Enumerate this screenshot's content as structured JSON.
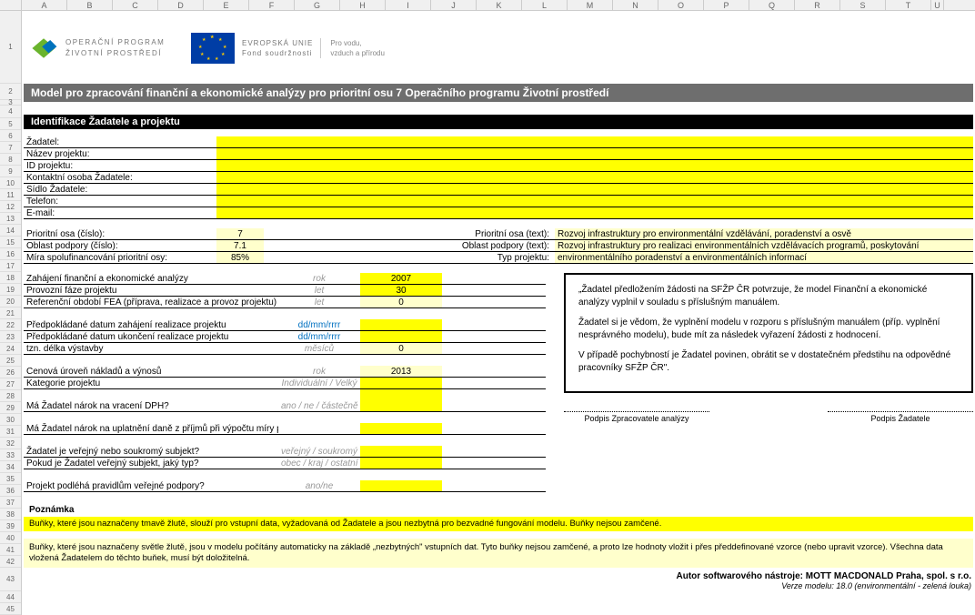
{
  "columns": [
    "A",
    "B",
    "C",
    "D",
    "E",
    "F",
    "G",
    "H",
    "I",
    "J",
    "K",
    "L",
    "M",
    "N",
    "O",
    "P",
    "Q",
    "R",
    "S",
    "T",
    "U"
  ],
  "rows": [
    "1",
    "2",
    "3",
    "4",
    "5",
    "6",
    "7",
    "8",
    "9",
    "10",
    "11",
    "12",
    "13",
    "14",
    "15",
    "16",
    "17",
    "18",
    "19",
    "20",
    "21",
    "22",
    "23",
    "24",
    "25",
    "26",
    "27",
    "28",
    "29",
    "30",
    "31",
    "32",
    "33",
    "34",
    "35",
    "36",
    "37",
    "38",
    "39",
    "40",
    "41",
    "42",
    "43",
    "44",
    "45"
  ],
  "logo_opzp": {
    "l1": "OPERAČNÍ PROGRAM",
    "l2": "ŽIVOTNÍ PROSTŘEDÍ"
  },
  "eu": {
    "l1": "EVROPSKÁ UNIE",
    "l2": "Fond soudržnosti",
    "r1": "Pro vodu,",
    "r2": "vzduch a přírodu"
  },
  "title": "Model pro zpracování finanční a ekonomické analýzy pro prioritní osu 7 Operačního programu Životní prostředí",
  "section1": "Identifikace Žadatele a projektu",
  "labels": {
    "zadatel": "Žadatel:",
    "nazev": "Název projektu:",
    "idp": "ID projektu:",
    "kontakt": "Kontaktní osoba Žadatele:",
    "sidlo": "Sídlo Žadatele:",
    "telefon": "Telefon:",
    "email": "E-mail:"
  },
  "priority": {
    "osa_l": "Prioritní osa (číslo):",
    "osa_v": "7",
    "osa_tl": "Prioritní osa (text):",
    "osa_tv": "Rozvoj infrastruktury pro environmentální vzdělávání, poradenství a osvě",
    "oblast_l": "Oblast podpory (číslo):",
    "oblast_v": "7.1",
    "oblast_tl": "Oblast podpory (text):",
    "oblast_tv": "Rozvoj infrastruktury pro realizaci environmentálních vzdělávacích programů, poskytování",
    "mira_l": "Míra spolufinancování prioritní osy:",
    "mira_v": "85%",
    "typ_l": "Typ projektu:",
    "typ_v": "environmentálního poradenství a environmentálních informací"
  },
  "analysis": [
    {
      "l": "Zahájení finanční a ekonomické analýzy",
      "u": "rok",
      "v": "2007",
      "cls": "y",
      "ul": true
    },
    {
      "l": "Provozní fáze projektu",
      "u": "let",
      "v": "30",
      "cls": "y",
      "ul": true
    },
    {
      "l": "Referenční období FEA (příprava, realizace a provoz projektu)",
      "u": "let",
      "v": "0",
      "cls": "ly",
      "ul": true
    },
    {
      "gap": true
    },
    {
      "l": "Předpokládané datum zahájení realizace projektu",
      "u": "dd/mm/rrrr",
      "v": "",
      "cls": "y",
      "ul": true,
      "uc": "#0070c0"
    },
    {
      "l": "Předpokládané datum ukončení realizace projektu",
      "u": "dd/mm/rrrr",
      "v": "",
      "cls": "y",
      "ul": true,
      "uc": "#0070c0"
    },
    {
      "l": "tzn. délka výstavby",
      "u": "měsíců",
      "v": "0",
      "cls": "ly",
      "ul": true
    },
    {
      "gap": true
    },
    {
      "l": "Cenová úroveň nákladů a výnosů",
      "u": "rok",
      "v": "2013",
      "cls": "ly",
      "ul": true
    },
    {
      "l": "Kategorie projektu",
      "u": "Individuální / Velký",
      "v": "",
      "cls": "y",
      "ul": true
    },
    {
      "gap": true,
      "yright": true
    },
    {
      "l": "Má Žadatel nárok na vracení DPH?",
      "u": "ano / ne / částečně",
      "v": "",
      "cls": "y",
      "ul": true
    },
    {
      "gap": true
    },
    {
      "l": "Má Žadatel nárok na uplatnění daně z příjmů při výpočtu míry podpoano / ne",
      "u": "",
      "v": "",
      "cls": "y",
      "ul": true,
      "uwide": true
    },
    {
      "gap": true
    },
    {
      "l": "Žadatel je veřejný nebo soukromý subjekt?",
      "u": "veřejný / soukromý",
      "v": "",
      "cls": "y",
      "ul": true
    },
    {
      "l": "Pokud je Žadatel veřejný subjekt, jaký typ?",
      "u": "obec / kraj / ostatní veřejný",
      "v": "",
      "cls": "y",
      "ul": true
    },
    {
      "gap": true
    },
    {
      "l": "Projekt podléhá pravidlům veřejné podpory?",
      "u": "ano/ne",
      "v": "",
      "cls": "y",
      "ul": true
    }
  ],
  "info": {
    "p1": "„Žadatel předložením žádosti na SFŽP ČR potvrzuje, že model Finanční a ekonomické analýzy vyplnil v souladu s příslušným manuálem.",
    "p2": "Žadatel si je vědom, že vyplnění modelu v rozporu s příslušným manuálem (příp. vyplnění nesprávného modelu), bude mít za následek vyřazení žádosti z hodnocení.",
    "p3": "V případě pochybností je Žadatel povinen, obrátit se v dostatečném předstihu na odpovědné pracovníky SFŽP ČR\"."
  },
  "sig": {
    "left": "Podpis Zpracovatele analýzy",
    "right": "Podpis Žadatele"
  },
  "note_title": "Poznámka",
  "note_yellow": "Buňky, které jsou naznačeny tmavě žlutě, slouží pro vstupní data, vyžadovaná od Žadatele a jsou nezbytná pro bezvadné fungování modelu. Buňky nejsou zamčené.",
  "note_light": "Buňky, které jsou naznačeny světle žlutě, jsou v modelu počítány automaticky na základě „nezbytných\" vstupních dat. Tyto buňky nejsou zamčené, a proto lze hodnoty vložit i přes předdefinované vzorce (nebo upravit vzorce). Všechna data vložená Žadatelem do těchto buňek, musí být doložitelná.",
  "author": "Autor softwarového nástroje: MOTT MACDONALD Praha, spol. s r.o.",
  "version": "Verze modelu: 18.0 (environmentální - zelená louka)"
}
